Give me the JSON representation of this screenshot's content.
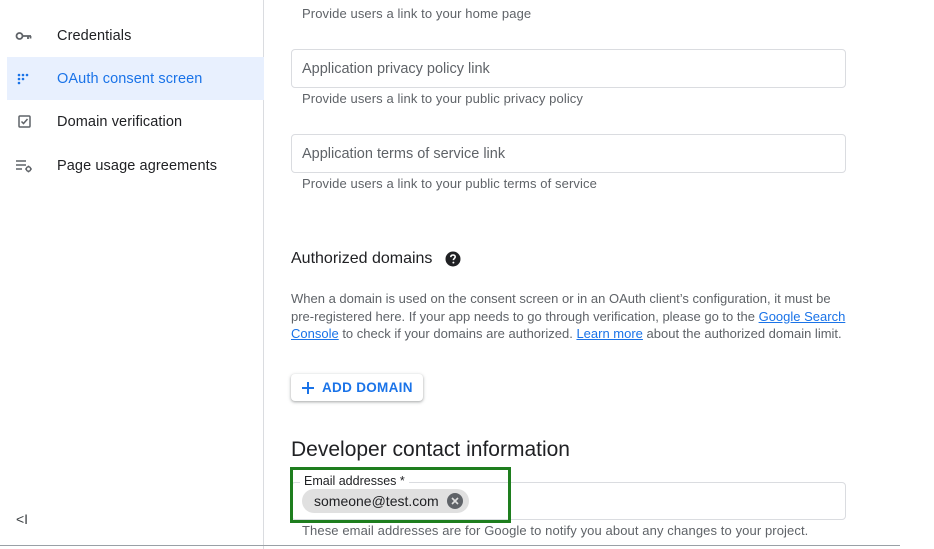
{
  "sidebar": {
    "items": [
      {
        "label": "Credentials",
        "icon": "key-icon",
        "active": false
      },
      {
        "label": "OAuth consent screen",
        "icon": "oauth-dots-icon",
        "active": true
      },
      {
        "label": "Domain verification",
        "icon": "checkbox-icon",
        "active": false
      },
      {
        "label": "Page usage agreements",
        "icon": "list-settings-icon",
        "active": false
      }
    ],
    "collapse_label": "<I"
  },
  "form": {
    "home_page_helper": "Provide users a link to your home page",
    "privacy_placeholder": "Application privacy policy link",
    "privacy_helper": "Provide users a link to your public privacy policy",
    "tos_placeholder": "Application terms of service link",
    "tos_helper": "Provide users a link to your public terms of service"
  },
  "authorized_domains": {
    "title": "Authorized domains",
    "desc_part1": "When a domain is used on the consent screen or in an OAuth client’s configuration, it must be pre-registered here. If your app needs to go through verification, please go to the ",
    "link_search_console": "Google Search Console",
    "desc_part2": " to check if your domains are authorized. ",
    "link_learn_more": "Learn more",
    "desc_part3": " about the authorized domain limit.",
    "add_button": "ADD DOMAIN"
  },
  "developer_contact": {
    "title": "Developer contact information",
    "email_label": "Email addresses *",
    "email_chip": "someone@test.com",
    "helper": "These email addresses are for Google to notify you about any changes to your project."
  },
  "colors": {
    "accent": "#1a73e8",
    "active_bg": "#e8f0fe",
    "highlight": "#1e7e1e"
  }
}
